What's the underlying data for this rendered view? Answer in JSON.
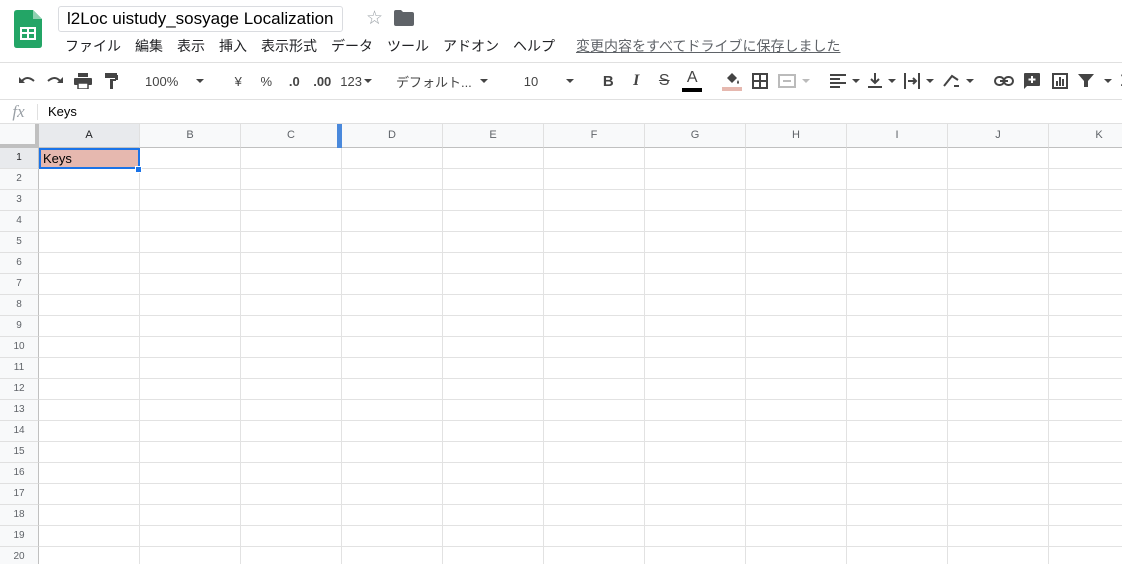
{
  "header": {
    "title": "l2Loc uistudy_sosyage Localization",
    "menu": [
      "ファイル",
      "編集",
      "表示",
      "挿入",
      "表示形式",
      "データ",
      "ツール",
      "アドオン",
      "ヘルプ"
    ],
    "save_status": "変更内容をすべてドライブに保存しました"
  },
  "toolbar": {
    "zoom": "100%",
    "currency": "¥",
    "percent": "%",
    "decrease_decimal": ".0",
    "increase_decimal": ".00",
    "number_format": "123",
    "font": "デフォルト...",
    "font_size": "10",
    "bold": "B",
    "italic": "I",
    "strikethrough": "S",
    "text_color_letter": "A",
    "text_color": "#000000",
    "fill_color": "#e6b8af"
  },
  "formula_bar": {
    "fx": "fx",
    "value": "Keys"
  },
  "grid": {
    "columns": [
      "A",
      "B",
      "C",
      "D",
      "E",
      "F",
      "G",
      "H",
      "I",
      "J",
      "K"
    ],
    "rows": [
      "1",
      "2",
      "3",
      "4",
      "5",
      "6",
      "7",
      "8",
      "9",
      "10",
      "11",
      "12",
      "13",
      "14",
      "15",
      "16",
      "17",
      "18",
      "19",
      "20"
    ],
    "cells": {
      "A1": "Keys"
    },
    "selected_cell": "A1",
    "accent": "#1a73e8"
  }
}
